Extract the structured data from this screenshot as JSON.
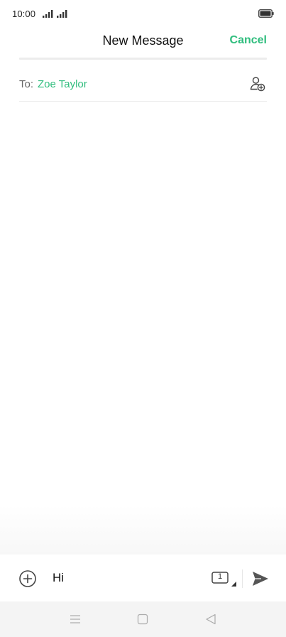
{
  "status_bar": {
    "time": "10:00",
    "icons": [
      "signal-icon",
      "signal-icon",
      "battery-icon"
    ]
  },
  "header": {
    "title": "New Message",
    "cancel_label": "Cancel"
  },
  "recipient": {
    "label": "To:",
    "name": "Zoe Taylor",
    "add_icon": "add-contact-icon"
  },
  "compose": {
    "attach_icon": "plus-circle-icon",
    "message_text": "Hi",
    "sim_label": "1",
    "sim_icon": "sim-card-icon",
    "send_icon": "send-icon"
  },
  "nav_bar": {
    "icons": [
      "menu-icon",
      "home-icon",
      "back-icon"
    ]
  },
  "colors": {
    "accent": "#2fbd7d",
    "text_primary": "#111111",
    "text_secondary": "#666666",
    "divider": "#ececec",
    "nav_background": "#f4f4f4"
  }
}
